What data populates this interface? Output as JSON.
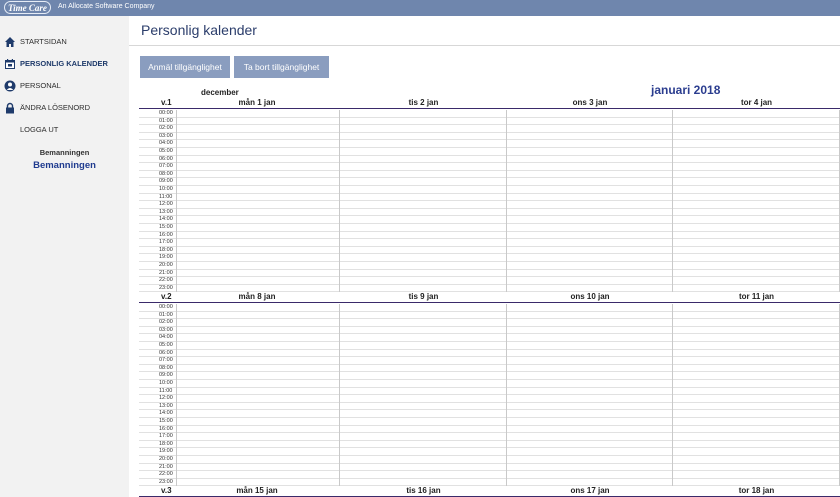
{
  "header": {
    "logo": "Time Care",
    "tagline": "An Allocate Software Company"
  },
  "sidebar": {
    "items": [
      {
        "label": "STARTSIDAN",
        "icon": "home-icon"
      },
      {
        "label": "PERSONLIG KALENDER",
        "icon": "calendar-icon",
        "active": true
      },
      {
        "label": "PERSONAL",
        "icon": "person-icon"
      },
      {
        "label": "ÄNDRA LÖSENORD",
        "icon": "lock-icon"
      },
      {
        "label": "LOGGA UT",
        "icon": ""
      }
    ],
    "brand_small": "Bemanningen",
    "brand_big": "Bemanningen"
  },
  "main": {
    "title": "Personlig kalender",
    "buttons": {
      "report": "Anmäl tillgänglighet",
      "remove": "Ta bort tillgänglighet"
    }
  },
  "calendar": {
    "prev_month": "december",
    "month_title": "januari 2018",
    "hours": [
      "00:00",
      "01:00",
      "02:00",
      "03:00",
      "04:00",
      "05:00",
      "06:00",
      "07:00",
      "08:00",
      "09:00",
      "10:00",
      "11:00",
      "12:00",
      "13:00",
      "14:00",
      "15:00",
      "16:00",
      "17:00",
      "18:00",
      "19:00",
      "20:00",
      "21:00",
      "22:00",
      "23:00"
    ],
    "weeks": [
      {
        "week": "v.1",
        "days": [
          "mån 1 jan",
          "tis 2 jan",
          "ons 3 jan",
          "tor 4 jan"
        ]
      },
      {
        "week": "v.2",
        "days": [
          "mån 8 jan",
          "tis 9 jan",
          "ons 10 jan",
          "tor 11 jan"
        ]
      },
      {
        "week": "v.3",
        "days": [
          "mån 15 jan",
          "tis 16 jan",
          "ons 17 jan",
          "tor 18 jan"
        ]
      }
    ]
  },
  "colors": {
    "topbar": "#6f86ad",
    "accent": "#2b3d8f",
    "button": "#8a9dbf",
    "week_line": "#3a2a6a"
  }
}
